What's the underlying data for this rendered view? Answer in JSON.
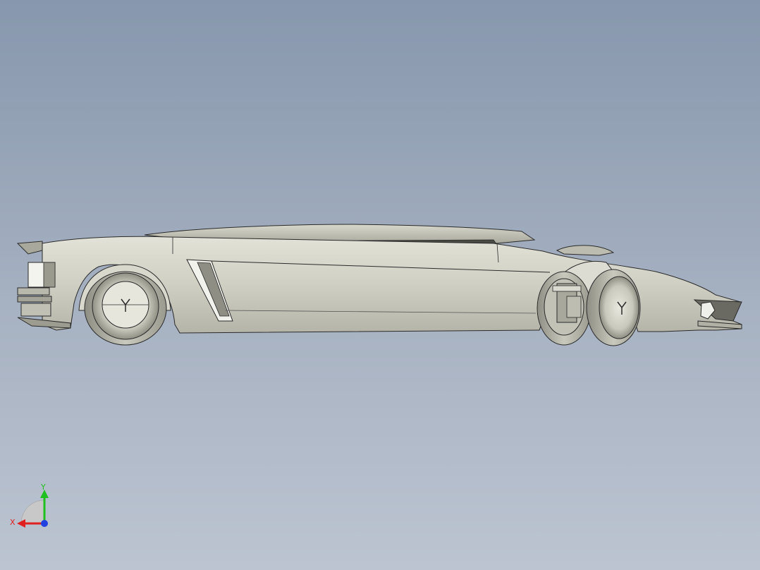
{
  "viewport": {
    "background_top": "#8797ad",
    "background_bottom": "#bcc4d1"
  },
  "model": {
    "body_color": "#cfcfc3",
    "shadow_color": "#a3a396",
    "edge_color": "#2a2a2a"
  },
  "triad": {
    "x_label": "X",
    "y_label": "Y",
    "x_color": "#e02020",
    "y_color": "#20c020",
    "z_color": "#2040e0"
  }
}
